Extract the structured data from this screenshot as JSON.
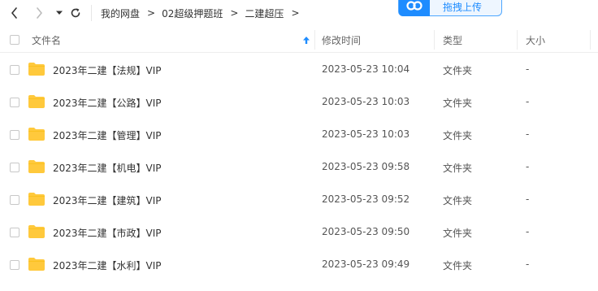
{
  "breadcrumb": [
    "我的网盘",
    "02超级押题班",
    "二建超压"
  ],
  "breadcrumb_separator": ">",
  "upload_button": {
    "label": "拖拽上传"
  },
  "columns": {
    "name": "文件名",
    "modified": "修改时间",
    "type": "类型",
    "size": "大小"
  },
  "files": [
    {
      "name": "2023年二建【法规】VIP",
      "modified": "2023-05-23 10:04",
      "type": "文件夹",
      "size": "-"
    },
    {
      "name": "2023年二建【公路】VIP",
      "modified": "2023-05-23 10:03",
      "type": "文件夹",
      "size": "-"
    },
    {
      "name": "2023年二建【管理】VIP",
      "modified": "2023-05-23 10:03",
      "type": "文件夹",
      "size": "-"
    },
    {
      "name": "2023年二建【机电】VIP",
      "modified": "2023-05-23 09:58",
      "type": "文件夹",
      "size": "-"
    },
    {
      "name": "2023年二建【建筑】VIP",
      "modified": "2023-05-23 09:52",
      "type": "文件夹",
      "size": "-"
    },
    {
      "name": "2023年二建【市政】VIP",
      "modified": "2023-05-23 09:50",
      "type": "文件夹",
      "size": "-"
    },
    {
      "name": "2023年二建【水利】VIP",
      "modified": "2023-05-23 09:49",
      "type": "文件夹",
      "size": "-"
    }
  ],
  "colors": {
    "accent": "#1e8cff",
    "folder": "#ffc93c",
    "folder_tab": "#f5b800"
  }
}
